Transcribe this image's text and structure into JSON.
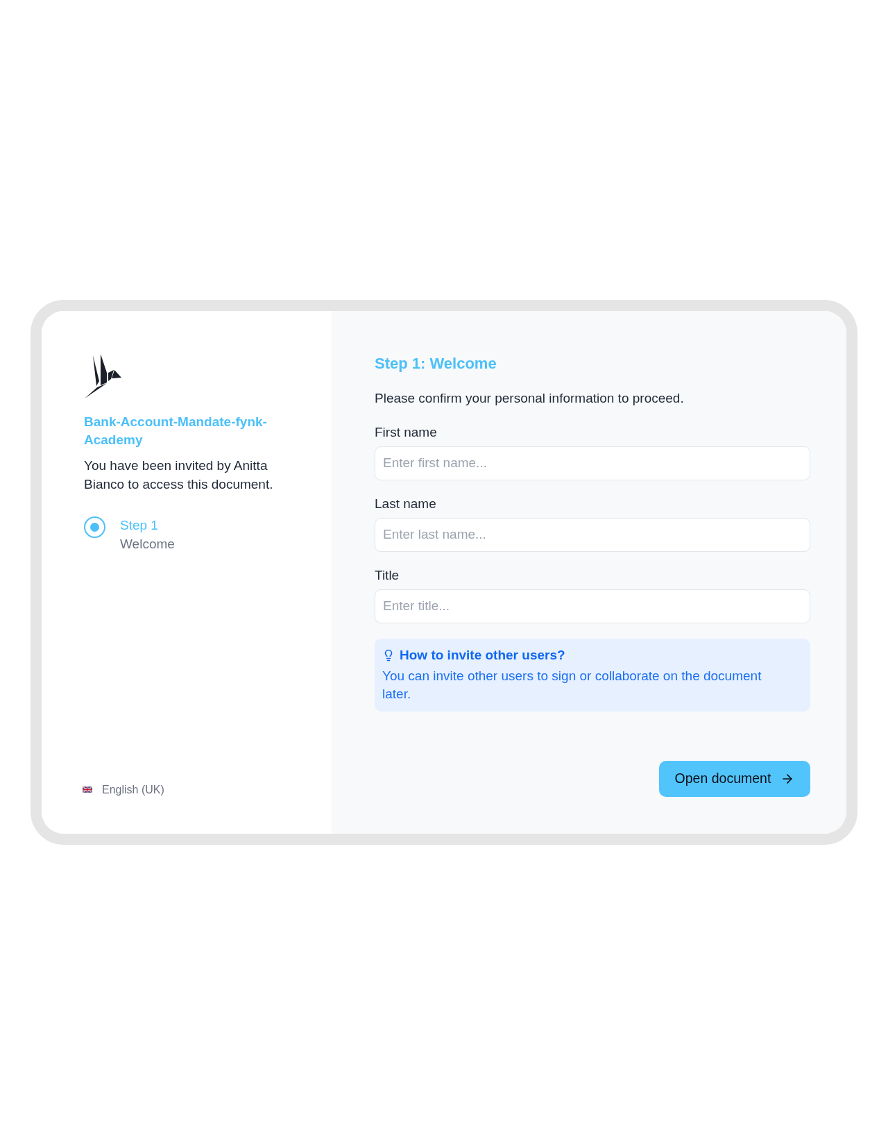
{
  "document": {
    "title": "Bank-Account-Mandate-fynk-Academy",
    "invitation": "You have been invited by Anitta Bianco to access this document."
  },
  "steps": [
    {
      "label": "Step 1",
      "name": "Welcome",
      "selected": true
    }
  ],
  "language": {
    "label": "English (UK)"
  },
  "form": {
    "heading": "Step 1: Welcome",
    "intro": "Please confirm your personal information to proceed.",
    "fields": [
      {
        "label": "First name",
        "placeholder": "Enter first name..."
      },
      {
        "label": "Last name",
        "placeholder": "Enter last name..."
      },
      {
        "label": "Title",
        "placeholder": "Enter title..."
      }
    ]
  },
  "tip": {
    "title": "How to invite other users?",
    "text": "You can invite other users to sign or collaborate on the document later."
  },
  "primary_button": {
    "label": "Open document"
  }
}
